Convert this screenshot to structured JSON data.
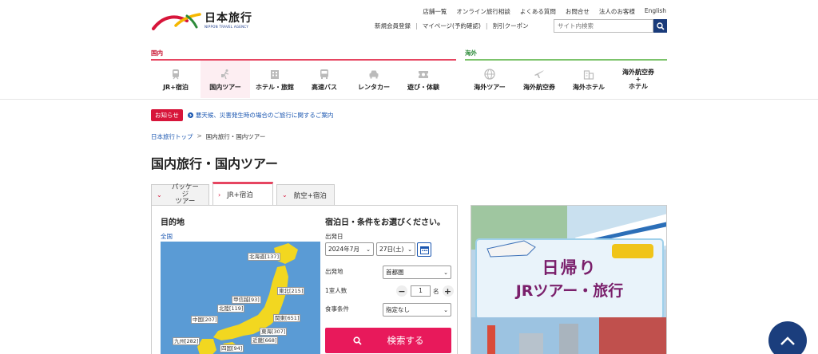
{
  "brand": {
    "logo_jp": "日本旅行",
    "logo_en": "NIPPON TRAVEL AGENCY",
    "colors": {
      "primary_red": "#d7153a",
      "pink": "#e8195b",
      "navy": "#1b3e7d",
      "green": "#7cc36b"
    }
  },
  "util_nav": [
    "店舗一覧",
    "オンライン旅行相談",
    "よくある質問",
    "お問合せ",
    "法人のお客様",
    "English"
  ],
  "util_nav2": [
    "新規会員登録",
    "マイページ(予約確認)",
    "割引クーポン"
  ],
  "site_search": {
    "placeholder": "サイト内検索",
    "icon": "search-icon"
  },
  "sections": {
    "domestic": "国内",
    "overseas": "海外"
  },
  "domestic_nav": [
    {
      "label": "JR+宿泊",
      "icon": "train-icon"
    },
    {
      "label": "国内ツアー",
      "icon": "tour-icon",
      "active": true
    },
    {
      "label": "ホテル・旅館",
      "icon": "hotel-icon"
    },
    {
      "label": "高速バス",
      "icon": "bus-icon"
    },
    {
      "label": "レンタカー",
      "icon": "car-icon"
    },
    {
      "label": "遊び・体験",
      "icon": "ticket-icon"
    }
  ],
  "overseas_nav": [
    {
      "label": "海外ツアー",
      "icon": "globe-icon"
    },
    {
      "label": "海外航空券",
      "icon": "plane-icon"
    },
    {
      "label": "海外ホテル",
      "icon": "building-icon"
    },
    {
      "label": "海外航空券\n+\nホテル",
      "icon": ""
    }
  ],
  "notice": {
    "badge": "お知らせ",
    "text": "悪天候、災害発生時の場合のご旅行に関するご案内"
  },
  "breadcrumb": {
    "home": "日本旅行トップ",
    "sep": ">",
    "current": "国内旅行・国内ツアー"
  },
  "page_title": "国内旅行・国内ツアー",
  "tabs": [
    {
      "label": "パッケージ\nツアー"
    },
    {
      "label": "JR+宿泊",
      "active": true
    },
    {
      "label": "航空+宿泊"
    }
  ],
  "search_panel": {
    "destination_title": "目的地",
    "all_link": "全国",
    "regions": {
      "hokkaido": "北海道[137]",
      "tohoku": "東北[215]",
      "koshinetsu": "甲信越[93]",
      "hokuriku": "北陸[119]",
      "kanto": "関東[651]",
      "chugoku": "中国[207]",
      "tokai": "東海[307]",
      "kinki": "近畿[668]",
      "kyushu": "九州[282]",
      "shikoku": "四国[94]"
    },
    "conditions_title": "宿泊日・条件をお選びください。",
    "departure_date_label": "出発日",
    "month_value": "2024年7月",
    "day_value": "27日(土)",
    "departure_place_label": "出発地",
    "departure_place_value": "首都圏",
    "people_label": "1室人数",
    "people_value": "1",
    "people_unit": "名",
    "meal_label": "食事条件",
    "meal_value": "指定なし",
    "submit_label": "検索する"
  },
  "banner": {
    "line1": "日帰り",
    "line2": "JRツアー・旅行"
  }
}
